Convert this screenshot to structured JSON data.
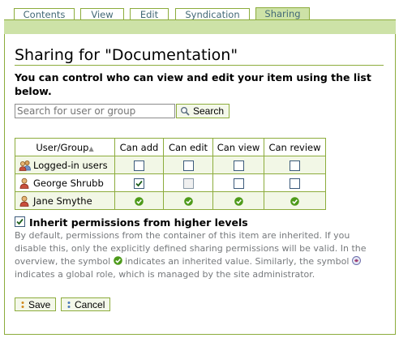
{
  "tabs": [
    {
      "label": "Contents"
    },
    {
      "label": "View"
    },
    {
      "label": "Edit"
    },
    {
      "label": "Syndication"
    },
    {
      "label": "Sharing"
    }
  ],
  "page": {
    "title": "Sharing for \"Documentation\"",
    "description": "You can control who can view and edit your item using the list below."
  },
  "search": {
    "placeholder": "Search for user or group",
    "button_label": "Search",
    "icon": "magnifier-icon"
  },
  "table": {
    "headers": [
      "User/Group",
      "Can add",
      "Can edit",
      "Can view",
      "Can review"
    ],
    "sort_indicator": "▲",
    "rows": [
      {
        "name": "Logged-in users",
        "icon": "group-icon",
        "cells": [
          "unchecked",
          "unchecked",
          "unchecked",
          "unchecked"
        ]
      },
      {
        "name": "George Shrubb",
        "icon": "user-icon",
        "cells": [
          "checked",
          "disabled",
          "unchecked",
          "unchecked"
        ]
      },
      {
        "name": "Jane Smythe",
        "icon": "user-icon",
        "cells": [
          "inherited",
          "inherited",
          "inherited",
          "inherited"
        ]
      }
    ]
  },
  "inherit": {
    "label": "Inherit permissions from higher levels",
    "checked": true,
    "help_part1": "By default, permissions from the container of this item are inherited. If you disable this, only the explicitly defined sharing permissions will be valid. In the overview, the symbol",
    "help_part2": "indicates an inherited value. Similarly, the symbol",
    "help_part3": "indicates a global role, which is managed by the site administrator."
  },
  "buttons": {
    "save": "Save",
    "cancel": "Cancel"
  },
  "colors": {
    "accent_green": "#8cac3c",
    "tab_active_bg": "#cde2a7",
    "tab_text": "#436976",
    "inherited_check": "#4d9a1a"
  }
}
